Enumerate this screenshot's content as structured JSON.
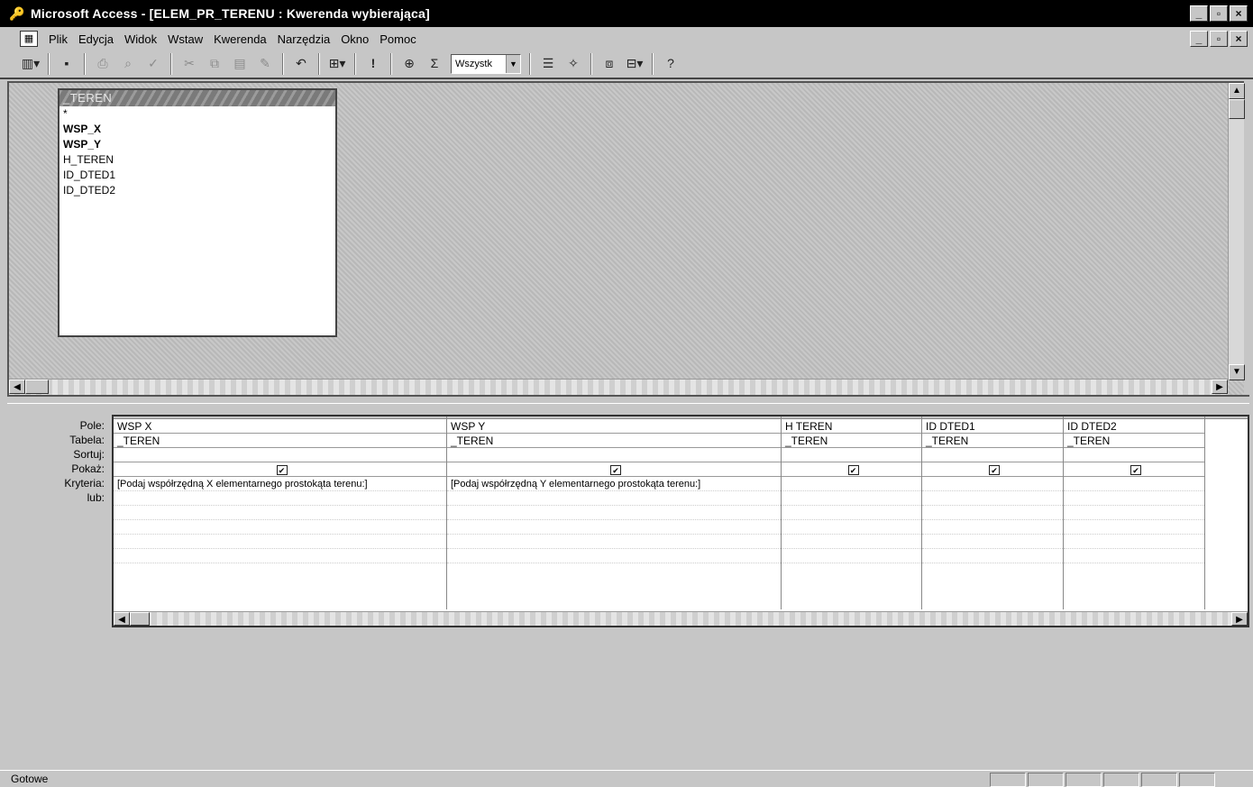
{
  "window": {
    "title": "Microsoft Access - [ELEM_PR_TERENU : Kwerenda wybierająca]",
    "controls": [
      "_",
      "▫",
      "×"
    ]
  },
  "menu": {
    "items": [
      "Plik",
      "Edycja",
      "Widok",
      "Wstaw",
      "Kwerenda",
      "Narzędzia",
      "Okno",
      "Pomoc"
    ]
  },
  "toolbar": {
    "combo_value": "Wszystk"
  },
  "table_box": {
    "title": "_TEREN",
    "fields": [
      "*",
      "WSP_X",
      "WSP_Y",
      "H_TEREN",
      "ID_DTED1",
      "ID_DTED2"
    ],
    "key_fields": [
      "WSP_X",
      "WSP_Y"
    ]
  },
  "grid": {
    "row_labels": [
      "Pole:",
      "Tabela:",
      "Sortuj:",
      "Pokaż:",
      "Kryteria:",
      "lub:"
    ],
    "columns": [
      {
        "field": "WSP X",
        "table": "_TEREN",
        "sort": "",
        "show": true,
        "criteria": "[Podaj współrzędną X elementarnego prostokąta terenu:]"
      },
      {
        "field": "WSP Y",
        "table": "_TEREN",
        "sort": "",
        "show": true,
        "criteria": "[Podaj współrzędną Y elementarnego prostokąta terenu:]"
      },
      {
        "field": "H TEREN",
        "table": "_TEREN",
        "sort": "",
        "show": true,
        "criteria": ""
      },
      {
        "field": "ID DTED1",
        "table": "_TEREN",
        "sort": "",
        "show": true,
        "criteria": ""
      },
      {
        "field": "ID DTED2",
        "table": "_TEREN",
        "sort": "",
        "show": true,
        "criteria": ""
      }
    ]
  },
  "status": {
    "text": "Gotowe"
  }
}
